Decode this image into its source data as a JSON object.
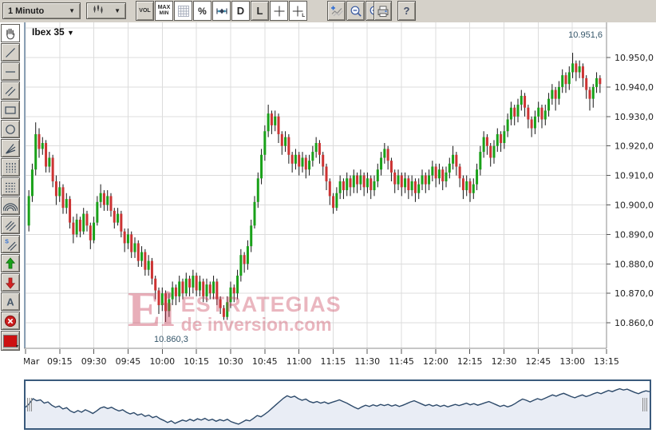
{
  "toolbar": {
    "interval_dropdown": {
      "value": "1 Minuto",
      "arrow": "▼"
    },
    "chart_type_dropdown": {
      "icon": "candlestick-icon",
      "arrow": "▼"
    },
    "buttons": [
      {
        "id": "volume",
        "group": 1,
        "label1": "VOL",
        "pressed": false
      },
      {
        "id": "max-min",
        "group": 1,
        "label1": "MAX",
        "label2": "MIN",
        "pressed": true
      },
      {
        "id": "grid",
        "group": 1,
        "icon": "grid-icon",
        "pressed": true
      },
      {
        "id": "percent",
        "group": 1,
        "label1": "%",
        "style": "pct",
        "pressed": true
      },
      {
        "id": "range-band",
        "group": 1,
        "icon": "range-icon",
        "pressed": true
      },
      {
        "id": "day-scale",
        "group": 1,
        "label1": "D",
        "style": "big",
        "pressed": true
      },
      {
        "id": "line-scale",
        "group": 1,
        "label1": "L",
        "style": "big",
        "pressed": false
      },
      {
        "id": "crosshair",
        "group": 1,
        "icon": "crosshair-icon",
        "pressed": true
      },
      {
        "id": "crosshair-l",
        "group": 1,
        "icon": "crosshair-l-icon",
        "pressed": true
      },
      {
        "id": "add-indicator",
        "group": 2,
        "icon": "add-indicator-icon",
        "pressed": false
      },
      {
        "id": "zoom-out",
        "group": 2,
        "icon": "zoom-out-icon",
        "pressed": false
      },
      {
        "id": "zoom-in",
        "group": 2,
        "icon": "zoom-in-icon",
        "pressed": false
      },
      {
        "id": "print",
        "group": 3,
        "icon": "print-icon",
        "pressed": false
      },
      {
        "id": "help",
        "group": 4,
        "label1": "?",
        "style": "qm",
        "pressed": false
      }
    ]
  },
  "sidebar": {
    "tools": [
      {
        "id": "pan",
        "icon": "hand-icon",
        "pressed": true
      },
      {
        "id": "trend-line",
        "icon": "trend-line-icon",
        "pressed": false
      },
      {
        "id": "horizontal-line",
        "icon": "horizontal-line-icon",
        "pressed": false
      },
      {
        "id": "parallel-lines",
        "icon": "parallel-lines-icon",
        "pressed": false
      },
      {
        "id": "rectangle",
        "icon": "rectangle-icon",
        "pressed": false
      },
      {
        "id": "ellipse",
        "icon": "ellipse-icon",
        "pressed": false
      },
      {
        "id": "fan-lines",
        "icon": "fan-lines-icon",
        "pressed": false
      },
      {
        "id": "fibonacci-time-zones",
        "icon": "vertical-dashed-icon",
        "pressed": false
      },
      {
        "id": "fibonacci-retracement",
        "icon": "horizontal-dashed-icon",
        "pressed": false
      },
      {
        "id": "fibonacci-arcs",
        "icon": "arcs-icon",
        "pressed": false
      },
      {
        "id": "speed-lines",
        "icon": "speed-lines-icon",
        "pressed": false
      },
      {
        "id": "s-channel",
        "icon": "s-channel-icon",
        "label": "S",
        "pressed": false
      },
      {
        "id": "arrow-up",
        "icon": "arrow-up-icon",
        "pressed": false
      },
      {
        "id": "arrow-down",
        "icon": "arrow-down-icon",
        "pressed": false
      },
      {
        "id": "text-note",
        "icon": "text-icon",
        "label": "A",
        "pressed": false
      },
      {
        "id": "delete",
        "icon": "delete-icon",
        "pressed": false
      },
      {
        "id": "color-picker",
        "icon": "color-swatch-icon",
        "pressed": false
      }
    ]
  },
  "chart": {
    "symbol_label": "Ibex 35",
    "symbol_arrow": "▼",
    "high_label": "10.951,6",
    "low_label": "10.860,3"
  },
  "watermark": {
    "logo": "Ei",
    "line1": "ESTRATEGIAS",
    "line2": "de inversion.com"
  },
  "colors": {
    "up": "#19a119",
    "up_dark": "#0f6b0f",
    "down": "#cc3333",
    "down_dark": "#8c1f1f",
    "wick": "#161616",
    "grid": "#dcdcdc",
    "axis": "#8c8c8c",
    "tick_text": "#1f1f1f",
    "plot_left_edge": "#8ba0b5",
    "label_accent": "#35566a",
    "nav_line": "#2d4a6a",
    "nav_fill": "#e9edf5",
    "nav_border": "#3a5a7c",
    "watermark_pink": "rgba(201,62,88,0.40)"
  },
  "chart_data": {
    "type": "candlestick",
    "title": "Ibex 35 - 1 Minuto",
    "session_high": 10951.6,
    "session_low": 10860.3,
    "y_axis": {
      "side": "right",
      "range": [
        10852,
        10962
      ],
      "ticks": [
        {
          "value": 10950,
          "label": "10.950,0"
        },
        {
          "value": 10940,
          "label": "10.940,0"
        },
        {
          "value": 10930,
          "label": "10.930,0"
        },
        {
          "value": 10920,
          "label": "10.920,0"
        },
        {
          "value": 10910,
          "label": "10.910,0"
        },
        {
          "value": 10900,
          "label": "10.900,0"
        },
        {
          "value": 10890,
          "label": "10.890,0"
        },
        {
          "value": 10880,
          "label": "10.880,0"
        },
        {
          "value": 10870,
          "label": "10.870,0"
        },
        {
          "value": 10860,
          "label": "10.860,0"
        }
      ],
      "extra_gridline_values": [
        10960
      ]
    },
    "x_axis": {
      "ticks": [
        "Mar",
        "09:15",
        "09:30",
        "09:45",
        "10:00",
        "10:15",
        "10:30",
        "10:45",
        "11:00",
        "11:15",
        "11:30",
        "11:45",
        "12:00",
        "12:15",
        "12:30",
        "12:45",
        "13:00",
        "13:15"
      ]
    },
    "grid": true,
    "candles_ohlc": [
      [
        10893,
        10905,
        10891,
        10903
      ],
      [
        10903,
        10914,
        10901,
        10912
      ],
      [
        10912,
        10928,
        10910,
        10924
      ],
      [
        10924,
        10926,
        10916,
        10919
      ],
      [
        10919,
        10923,
        10917,
        10921
      ],
      [
        10921,
        10922,
        10911,
        10913
      ],
      [
        10913,
        10918,
        10911,
        10916
      ],
      [
        10916,
        10917,
        10906,
        10908
      ],
      [
        10908,
        10910,
        10900,
        10903
      ],
      [
        10903,
        10908,
        10901,
        10906
      ],
      [
        10906,
        10907,
        10897,
        10899
      ],
      [
        10899,
        10904,
        10897,
        10902
      ],
      [
        10902,
        10903,
        10892,
        10894
      ],
      [
        10894,
        10896,
        10887,
        10890
      ],
      [
        10890,
        10897,
        10889,
        10895
      ],
      [
        10895,
        10896,
        10889,
        10891
      ],
      [
        10891,
        10899,
        10890,
        10897
      ],
      [
        10897,
        10898,
        10891,
        10893
      ],
      [
        10893,
        10894,
        10885,
        10888
      ],
      [
        10888,
        10896,
        10887,
        10894
      ],
      [
        10894,
        10903,
        10893,
        10901
      ],
      [
        10901,
        10907,
        10899,
        10904
      ],
      [
        10904,
        10905,
        10898,
        10900
      ],
      [
        10900,
        10905,
        10898,
        10903
      ],
      [
        10903,
        10904,
        10896,
        10898
      ],
      [
        10898,
        10899,
        10892,
        10894
      ],
      [
        10894,
        10899,
        10893,
        10897
      ],
      [
        10897,
        10898,
        10889,
        10891
      ],
      [
        10891,
        10892,
        10884,
        10887
      ],
      [
        10887,
        10892,
        10885,
        10890
      ],
      [
        10890,
        10891,
        10882,
        10884
      ],
      [
        10884,
        10889,
        10882,
        10887
      ],
      [
        10887,
        10888,
        10879,
        10881
      ],
      [
        10881,
        10886,
        10879,
        10884
      ],
      [
        10884,
        10885,
        10876,
        10878
      ],
      [
        10878,
        10883,
        10876,
        10881
      ],
      [
        10881,
        10882,
        10873,
        10875
      ],
      [
        10875,
        10876,
        10868,
        10871
      ],
      [
        10871,
        10872,
        10863,
        10866
      ],
      [
        10866,
        10872,
        10864,
        10870
      ],
      [
        10870,
        10871,
        10860.3,
        10864
      ],
      [
        10864,
        10870,
        10862,
        10868
      ],
      [
        10868,
        10874,
        10866,
        10872
      ],
      [
        10872,
        10873,
        10866,
        10869
      ],
      [
        10869,
        10876,
        10867,
        10874
      ],
      [
        10874,
        10875,
        10868,
        10870
      ],
      [
        10870,
        10877,
        10869,
        10875
      ],
      [
        10875,
        10876,
        10869,
        10872
      ],
      [
        10872,
        10878,
        10870,
        10876
      ],
      [
        10876,
        10877,
        10869,
        10871
      ],
      [
        10871,
        10876,
        10869,
        10874
      ],
      [
        10874,
        10875,
        10867,
        10869
      ],
      [
        10869,
        10875,
        10867,
        10873
      ],
      [
        10873,
        10874,
        10868,
        10870
      ],
      [
        10870,
        10876,
        10868,
        10874
      ],
      [
        10874,
        10875,
        10866,
        10868
      ],
      [
        10868,
        10869,
        10863,
        10865
      ],
      [
        10865,
        10866,
        10861,
        10862
      ],
      [
        10862,
        10869,
        10861,
        10867
      ],
      [
        10867,
        10874,
        10865,
        10872
      ],
      [
        10872,
        10873,
        10867,
        10870
      ],
      [
        10870,
        10878,
        10868,
        10876
      ],
      [
        10876,
        10885,
        10874,
        10883
      ],
      [
        10883,
        10884,
        10877,
        10880
      ],
      [
        10880,
        10888,
        10878,
        10886
      ],
      [
        10886,
        10895,
        10884,
        10893
      ],
      [
        10893,
        10903,
        10892,
        10901
      ],
      [
        10901,
        10911,
        10899,
        10909
      ],
      [
        10909,
        10919,
        10907,
        10917
      ],
      [
        10917,
        10927,
        10915,
        10925
      ],
      [
        10925,
        10934,
        10923,
        10931
      ],
      [
        10931,
        10932,
        10924,
        10927
      ],
      [
        10927,
        10932,
        10925,
        10930
      ],
      [
        10930,
        10931,
        10921,
        10924
      ],
      [
        10924,
        10925,
        10917,
        10920
      ],
      [
        10920,
        10925,
        10918,
        10923
      ],
      [
        10923,
        10924,
        10914,
        10917
      ],
      [
        10917,
        10918,
        10911,
        10914
      ],
      [
        10914,
        10919,
        10912,
        10917
      ],
      [
        10917,
        10918,
        10910,
        10913
      ],
      [
        10913,
        10918,
        10911,
        10916
      ],
      [
        10916,
        10917,
        10909,
        10912
      ],
      [
        10912,
        10917,
        10910,
        10915
      ],
      [
        10915,
        10920,
        10913,
        10918
      ],
      [
        10918,
        10923,
        10916,
        10921
      ],
      [
        10921,
        10922,
        10914,
        10917
      ],
      [
        10917,
        10918,
        10910,
        10913
      ],
      [
        10913,
        10914,
        10905,
        10908
      ],
      [
        10908,
        10909,
        10900,
        10903
      ],
      [
        10903,
        10904,
        10897,
        10899
      ],
      [
        10899,
        10906,
        10898,
        10904
      ],
      [
        10904,
        10910,
        10902,
        10908
      ],
      [
        10908,
        10909,
        10902,
        10905
      ],
      [
        10905,
        10911,
        10903,
        10909
      ],
      [
        10909,
        10910,
        10903,
        10906
      ],
      [
        10906,
        10912,
        10904,
        10910
      ],
      [
        10910,
        10911,
        10904,
        10907
      ],
      [
        10907,
        10912,
        10905,
        10910
      ],
      [
        10910,
        10911,
        10903,
        10906
      ],
      [
        10906,
        10911,
        10904,
        10909
      ],
      [
        10909,
        10910,
        10902,
        10905
      ],
      [
        10905,
        10910,
        10903,
        10908
      ],
      [
        10908,
        10914,
        10906,
        10912
      ],
      [
        10912,
        10918,
        10910,
        10916
      ],
      [
        10916,
        10921,
        10914,
        10919
      ],
      [
        10919,
        10920,
        10912,
        10915
      ],
      [
        10915,
        10916,
        10908,
        10911
      ],
      [
        10911,
        10912,
        10904,
        10907
      ],
      [
        10907,
        10912,
        10905,
        10910
      ],
      [
        10910,
        10911,
        10903,
        10906
      ],
      [
        10906,
        10911,
        10904,
        10909
      ],
      [
        10909,
        10910,
        10902,
        10905
      ],
      [
        10905,
        10910,
        10903,
        10908
      ],
      [
        10908,
        10909,
        10901,
        10904
      ],
      [
        10904,
        10909,
        10902,
        10907
      ],
      [
        10907,
        10912,
        10905,
        10910
      ],
      [
        10910,
        10911,
        10904,
        10907
      ],
      [
        10907,
        10912,
        10905,
        10910
      ],
      [
        10910,
        10915,
        10908,
        10913
      ],
      [
        10913,
        10914,
        10906,
        10909
      ],
      [
        10909,
        10914,
        10907,
        10912
      ],
      [
        10912,
        10913,
        10905,
        10908
      ],
      [
        10908,
        10913,
        10906,
        10911
      ],
      [
        10911,
        10916,
        10909,
        10914
      ],
      [
        10914,
        10920,
        10912,
        10917
      ],
      [
        10917,
        10918,
        10910,
        10913
      ],
      [
        10913,
        10914,
        10906,
        10909
      ],
      [
        10909,
        10910,
        10902,
        10905
      ],
      [
        10905,
        10910,
        10903,
        10908
      ],
      [
        10908,
        10909,
        10901,
        10904
      ],
      [
        10904,
        10909,
        10902,
        10907
      ],
      [
        10907,
        10914,
        10905,
        10912
      ],
      [
        10912,
        10920,
        10910,
        10918
      ],
      [
        10918,
        10925,
        10916,
        10923
      ],
      [
        10923,
        10924,
        10917,
        10920
      ],
      [
        10920,
        10921,
        10913,
        10916
      ],
      [
        10916,
        10922,
        10914,
        10920
      ],
      [
        10920,
        10926,
        10918,
        10924
      ],
      [
        10924,
        10925,
        10918,
        10921
      ],
      [
        10921,
        10927,
        10919,
        10925
      ],
      [
        10925,
        10931,
        10923,
        10929
      ],
      [
        10929,
        10935,
        10927,
        10933
      ],
      [
        10933,
        10934,
        10927,
        10930
      ],
      [
        10930,
        10936,
        10928,
        10934
      ],
      [
        10934,
        10939,
        10932,
        10937
      ],
      [
        10937,
        10938,
        10930,
        10933
      ],
      [
        10933,
        10934,
        10926,
        10929
      ],
      [
        10929,
        10930,
        10923,
        10926
      ],
      [
        10926,
        10932,
        10924,
        10930
      ],
      [
        10930,
        10935,
        10928,
        10933
      ],
      [
        10933,
        10934,
        10926,
        10929
      ],
      [
        10929,
        10934,
        10927,
        10932
      ],
      [
        10932,
        10938,
        10930,
        10936
      ],
      [
        10936,
        10941,
        10934,
        10939
      ],
      [
        10939,
        10940,
        10932,
        10936
      ],
      [
        10936,
        10942,
        10934,
        10940
      ],
      [
        10940,
        10946,
        10938,
        10944
      ],
      [
        10944,
        10945,
        10938,
        10941
      ],
      [
        10941,
        10947,
        10939,
        10945
      ],
      [
        10945,
        10951.6,
        10943,
        10948
      ],
      [
        10948,
        10949,
        10942,
        10945
      ],
      [
        10945,
        10949,
        10943,
        10947
      ],
      [
        10947,
        10948,
        10940,
        10943
      ],
      [
        10943,
        10944,
        10936,
        10939
      ],
      [
        10939,
        10940,
        10932,
        10936
      ],
      [
        10936,
        10941,
        10933,
        10940
      ],
      [
        10940,
        10945,
        10938,
        10943
      ],
      [
        10943,
        10944,
        10938,
        10941
      ]
    ],
    "navigator": {
      "type": "area",
      "note": "overview of same series (candle closes)",
      "range": [
        10858,
        10955
      ]
    }
  }
}
